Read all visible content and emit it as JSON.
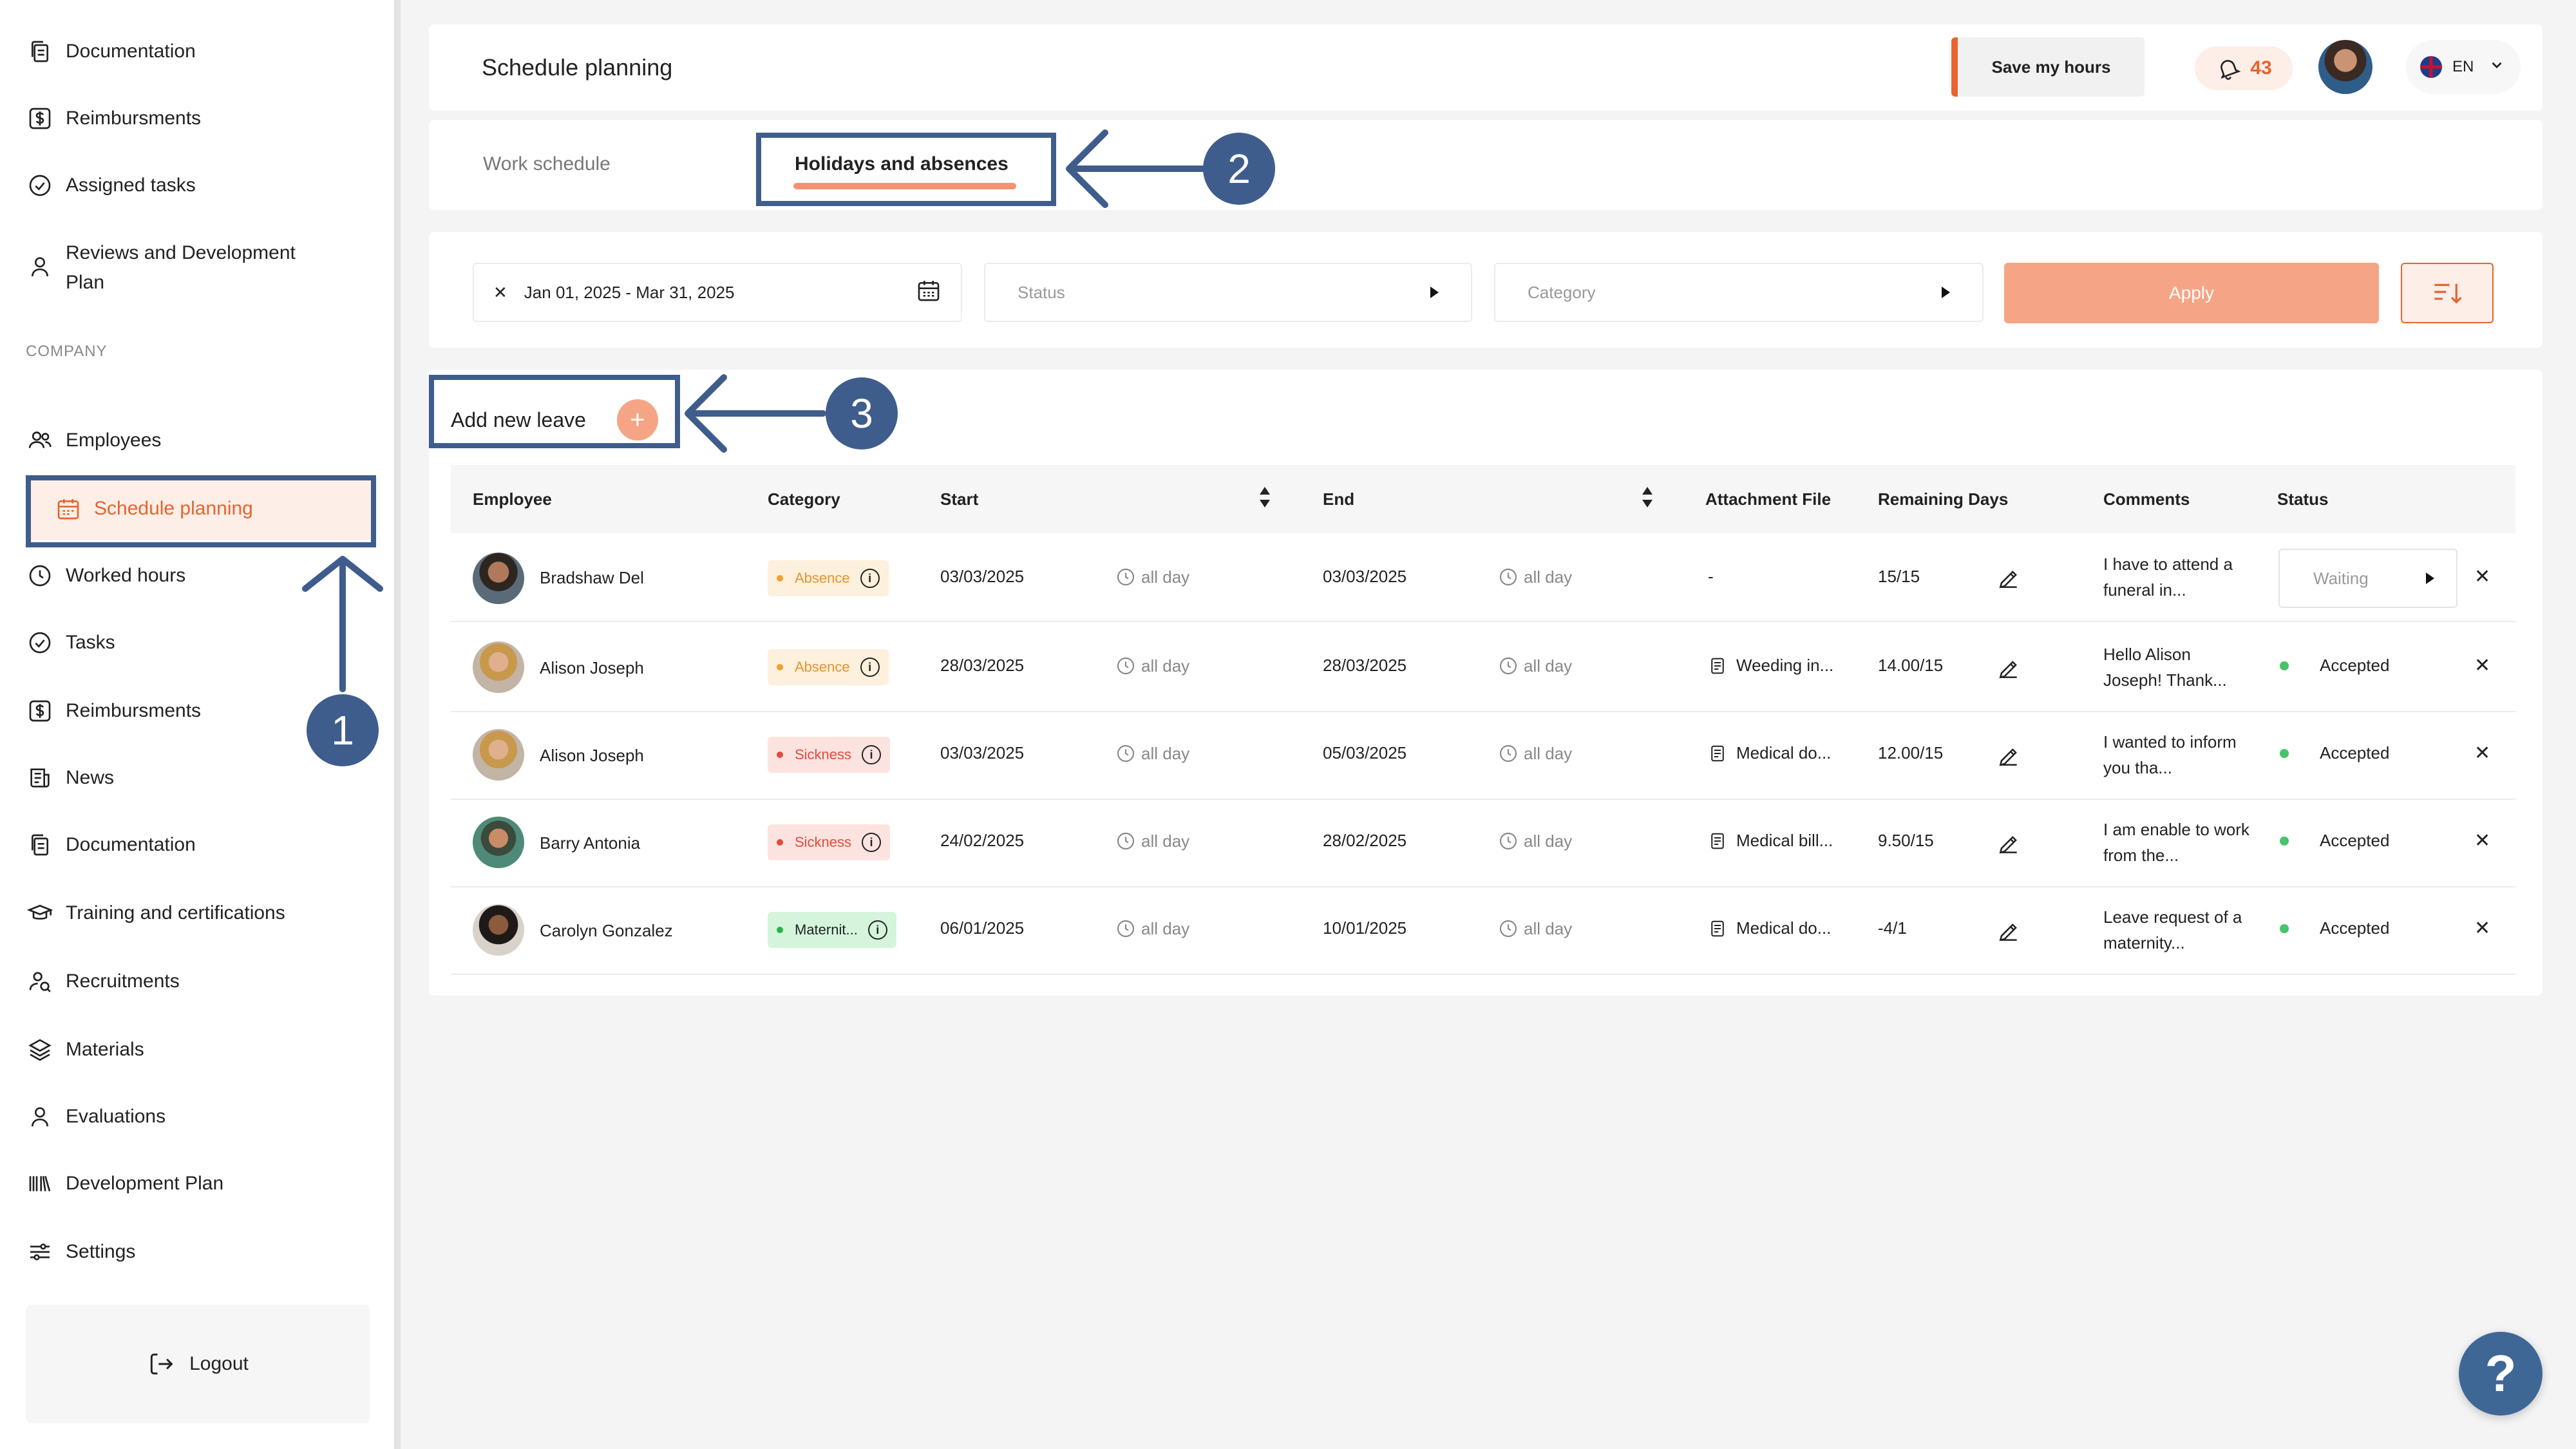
{
  "sidebar": {
    "top_items": [
      {
        "label": "Documentation"
      },
      {
        "label": "Reimbursments"
      },
      {
        "label": "Assigned tasks"
      },
      {
        "label": "Reviews and Development Plan"
      }
    ],
    "company_label": "COMPANY",
    "company_items": [
      {
        "label": "Employees"
      },
      {
        "label": "Schedule planning",
        "active": true
      },
      {
        "label": "Worked hours"
      },
      {
        "label": "Tasks"
      },
      {
        "label": "Reimbursments"
      },
      {
        "label": "News"
      },
      {
        "label": "Documentation"
      },
      {
        "label": "Training and certifications"
      },
      {
        "label": "Recruitments"
      },
      {
        "label": "Materials"
      },
      {
        "label": "Evaluations"
      },
      {
        "label": "Development Plan"
      },
      {
        "label": "Settings"
      }
    ],
    "logout_label": "Logout"
  },
  "header": {
    "title": "Schedule planning",
    "save_hours_label": "Save my hours",
    "notification_count": "43",
    "language": "EN"
  },
  "tabs": [
    {
      "label": "Work schedule",
      "active": false
    },
    {
      "label": "Holidays and absences",
      "active": true
    }
  ],
  "filters": {
    "date_range": "Jan 01, 2025 - Mar 31, 2025",
    "status_placeholder": "Status",
    "category_placeholder": "Category",
    "apply_label": "Apply"
  },
  "add_leave_label": "Add new leave",
  "table": {
    "columns": [
      "Employee",
      "Category",
      "Start",
      "End",
      "Attachment File",
      "Remaining Days",
      "Comments",
      "Status"
    ],
    "rows": [
      {
        "employee": "Bradshaw Del",
        "category": "Absence",
        "start": "03/03/2025",
        "start_time": "all day",
        "end": "03/03/2025",
        "end_time": "all day",
        "attachment": "-",
        "remaining": "15/15",
        "comment": "I have to attend a funeral in...",
        "status": "Waiting"
      },
      {
        "employee": "Alison Joseph",
        "category": "Absence",
        "start": "28/03/2025",
        "start_time": "all day",
        "end": "28/03/2025",
        "end_time": "all day",
        "attachment": "Weeding in...",
        "remaining": "14.00/15",
        "comment": "Hello Alison Joseph! Thank...",
        "status": "Accepted"
      },
      {
        "employee": "Alison Joseph",
        "category": "Sickness",
        "start": "03/03/2025",
        "start_time": "all day",
        "end": "05/03/2025",
        "end_time": "all day",
        "attachment": "Medical do...",
        "remaining": "12.00/15",
        "comment": "I wanted to inform you tha...",
        "status": "Accepted"
      },
      {
        "employee": "Barry Antonia",
        "category": "Sickness",
        "start": "24/02/2025",
        "start_time": "all day",
        "end": "28/02/2025",
        "end_time": "all day",
        "attachment": "Medical bill...",
        "remaining": "9.50/15",
        "comment": "I am enable to work from the...",
        "status": "Accepted"
      },
      {
        "employee": "Carolyn Gonzalez",
        "category": "Maternit...",
        "start": "06/01/2025",
        "start_time": "all day",
        "end": "10/01/2025",
        "end_time": "all day",
        "attachment": "Medical do...",
        "remaining": "-4/1",
        "comment": "Leave request of a maternity...",
        "status": "Accepted"
      }
    ]
  },
  "annotations": {
    "step1": "1",
    "step2": "2",
    "step3": "3"
  },
  "help_label": "?",
  "colors": {
    "accent": "#e8632f",
    "accent_light": "#fdeee7",
    "annotation": "#3f5d8c",
    "accepted": "#46c46a"
  }
}
